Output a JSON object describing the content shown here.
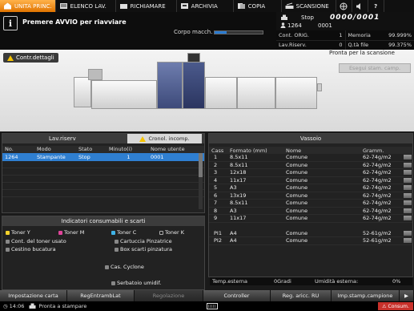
{
  "tabs": [
    {
      "label": "UNITA PRINC.",
      "icon": "home-icon",
      "active": true
    },
    {
      "label": "ELENCO LAV.",
      "icon": "list-icon",
      "active": false
    },
    {
      "label": "RICHIAMARE",
      "icon": "recall-icon",
      "active": false
    },
    {
      "label": "ARCHIVIA",
      "icon": "archive-icon",
      "active": false
    },
    {
      "label": "COPIA",
      "icon": "copy-icon",
      "active": false
    },
    {
      "label": "SCANSIONE",
      "icon": "scan-icon",
      "active": false
    }
  ],
  "message": "Premere AVVIO per riavviare",
  "corpo_label": "Corpo macch.",
  "corpo_progress": 0.25,
  "status": {
    "state": "Stop",
    "job_count": "0000/0001",
    "job_id": "1264",
    "job_index": "0001"
  },
  "counters": [
    {
      "label": "Cont. ORIG.",
      "value": "1"
    },
    {
      "label": "Memoria",
      "value": "99.999%"
    },
    {
      "label": "Lav.Riserv.",
      "value": "0"
    },
    {
      "label": "Q.tà file",
      "value": "99.375%"
    }
  ],
  "contr_label": "Contr.dettagli",
  "ready_scan": "Pronta per la scansione",
  "esegui_label": "Esegui stam. camp.",
  "lav_riserv": {
    "title": "Lav.riserv",
    "cronol": "Cronol. incomp.",
    "headers": [
      "No.",
      "Modo",
      "Stato",
      "Minuto(i)",
      "Nome utente"
    ],
    "rows": [
      [
        "1264",
        "Stampante",
        "Stop",
        "1",
        "0001"
      ]
    ]
  },
  "consumabili": {
    "title": "Indicatori consumabili e scarti",
    "items": [
      {
        "label": "Toner Y",
        "color": "#f4d22b"
      },
      {
        "label": "Toner M",
        "color": "#e0449a"
      },
      {
        "label": "Toner C",
        "color": "#3fb2e6"
      },
      {
        "label": "Toner K",
        "color": "#222222"
      },
      {
        "label": "Cont. del toner usato",
        "color": "#888888"
      },
      {
        "label": "Cartuccia Pinzatrice",
        "color": "#888888"
      },
      {
        "label": "Cestino bucatura",
        "color": "#888888"
      },
      {
        "label": "Box scarti pinzatura",
        "color": "#888888"
      },
      {
        "label": "Cas. Cyclone",
        "color": "#888888"
      },
      {
        "label": "Serbatoio umidif.",
        "color": "#888888"
      }
    ]
  },
  "vassoio": {
    "title": "Vassoio",
    "headers": [
      "Cass",
      "Formato (mm)",
      "Nome",
      "Gramm."
    ],
    "rows": [
      [
        "1",
        "8.5x11",
        "Comune",
        "62-74g/m2"
      ],
      [
        "2",
        "8.5x11",
        "Comune",
        "62-74g/m2"
      ],
      [
        "3",
        "12x18",
        "Comune",
        "62-74g/m2"
      ],
      [
        "4",
        "11x17",
        "Comune",
        "62-74g/m2"
      ],
      [
        "5",
        "A3",
        "Comune",
        "62-74g/m2"
      ],
      [
        "6",
        "13x19",
        "Comune",
        "62-74g/m2"
      ],
      [
        "7",
        "8.5x11",
        "Comune",
        "62-74g/m2"
      ],
      [
        "8",
        "A3",
        "Comune",
        "62-74g/m2"
      ],
      [
        "9",
        "11x17",
        "Comune",
        "62-74g/m2"
      ],
      [
        "PI1",
        "A4",
        "Comune",
        "52-61g/m2"
      ],
      [
        "PI2",
        "A4",
        "Comune",
        "52-61g/m2"
      ]
    ],
    "temp_label": "Temp.esterna",
    "temp_value": "0Gradi",
    "umid_label": "Umidità esterna:",
    "umid_value": "0%"
  },
  "buttons": [
    {
      "label": "Impostazione carta",
      "enabled": true
    },
    {
      "label": "RegEntrambLat",
      "enabled": true
    },
    {
      "label": "Regolazione",
      "enabled": false
    },
    {
      "label": "Controller",
      "enabled": true
    },
    {
      "label": "Reg. aricc. RU",
      "enabled": true
    },
    {
      "label": "Imp.stamp.campione",
      "enabled": true
    }
  ],
  "footer": {
    "time": "14:06",
    "status": "Pronta a stampare",
    "consum": "Consum."
  }
}
